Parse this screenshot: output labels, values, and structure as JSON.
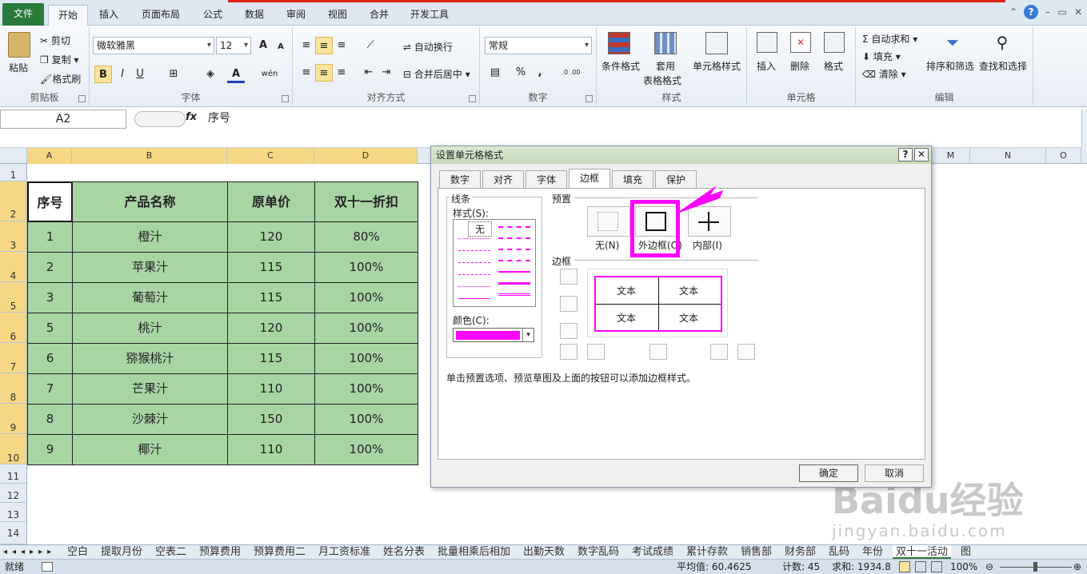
{
  "tabs": [
    "文件",
    "开始",
    "插入",
    "页面布局",
    "公式",
    "数据",
    "审阅",
    "视图",
    "合并",
    "开发工具"
  ],
  "ribbon": {
    "clipboard": {
      "paste": "粘贴",
      "cut": "剪切",
      "copy": "复制",
      "format_painter": "格式刷",
      "label": "剪贴板"
    },
    "font": {
      "name": "微软雅黑",
      "size": "12",
      "bold": "B",
      "italic": "I",
      "underline": "U",
      "grow": "A",
      "shrink": "A",
      "label": "字体"
    },
    "align": {
      "wrap": "自动换行",
      "merge": "合并后居中",
      "label": "对齐方式"
    },
    "number": {
      "format": "常规",
      "percent": "%",
      "comma": ",",
      "inc": ".0 .00",
      "label": "数字"
    },
    "styles": {
      "cond": "条件格式",
      "table": "套用",
      "table2": "表格格式",
      "cell": "单元格样式",
      "label": "样式"
    },
    "cells": {
      "insert": "插入",
      "delete": "删除",
      "format": "格式",
      "label": "单元格"
    },
    "edit": {
      "autosum": "自动求和",
      "fill": "填充",
      "clear": "清除",
      "sort": "排序和筛选",
      "find": "查找和选择",
      "label": "编辑"
    }
  },
  "formula": {
    "namebox": "A2",
    "fx": "fx",
    "content": "序号"
  },
  "columns": [
    "A",
    "B",
    "C",
    "D",
    "M",
    "N",
    "O"
  ],
  "rows": [
    "1",
    "2",
    "3",
    "4",
    "5",
    "6",
    "7",
    "8",
    "9",
    "10",
    "11",
    "12",
    "13",
    "14"
  ],
  "table": {
    "headers": [
      "序号",
      "产品名称",
      "原单价",
      "双十一折扣"
    ],
    "data": [
      [
        "1",
        "橙汁",
        "120",
        "80%"
      ],
      [
        "2",
        "苹果汁",
        "115",
        "100%"
      ],
      [
        "3",
        "葡萄汁",
        "115",
        "100%"
      ],
      [
        "5",
        "桃汁",
        "120",
        "100%"
      ],
      [
        "6",
        "猕猴桃汁",
        "115",
        "100%"
      ],
      [
        "7",
        "芒果汁",
        "110",
        "100%"
      ],
      [
        "8",
        "沙棘汁",
        "150",
        "100%"
      ],
      [
        "9",
        "椰汁",
        "110",
        "100%"
      ]
    ]
  },
  "dialog": {
    "title": "设置单元格格式",
    "help": "?",
    "close": "✕",
    "tabs": [
      "数字",
      "对齐",
      "字体",
      "边框",
      "填充",
      "保护"
    ],
    "line_group": "线条",
    "style_label": "样式(S):",
    "none": "无",
    "color_label": "颜色(C):",
    "preset_label": "预置",
    "preset_none": "无(N)",
    "preset_outline": "外边框(O)",
    "preset_inside": "内部(I)",
    "border_label": "边框",
    "preview_text": "文本",
    "hint": "单击预置选项、预览草图及上面的按钮可以添加边框样式。",
    "ok": "确定",
    "cancel": "取消",
    "accent": "#ff00ff"
  },
  "sheets": [
    "空白",
    "提取月份",
    "空表二",
    "预算费用",
    "预算费用二",
    "月工资标准",
    "姓名分表",
    "批量相乘后相加",
    "出勤天数",
    "数字乱码",
    "考试成绩",
    "累计存款",
    "销售部",
    "财务部",
    "乱码",
    "年份",
    "双十一活动",
    "图"
  ],
  "status": {
    "ready": "就绪",
    "avg": "平均值: 60.4625",
    "count": "计数: 45",
    "sum": "求和: 1934.8",
    "zoom": "100%"
  },
  "watermark": {
    "main": "Baidu经验",
    "sub": "jingyan.baidu.com"
  }
}
